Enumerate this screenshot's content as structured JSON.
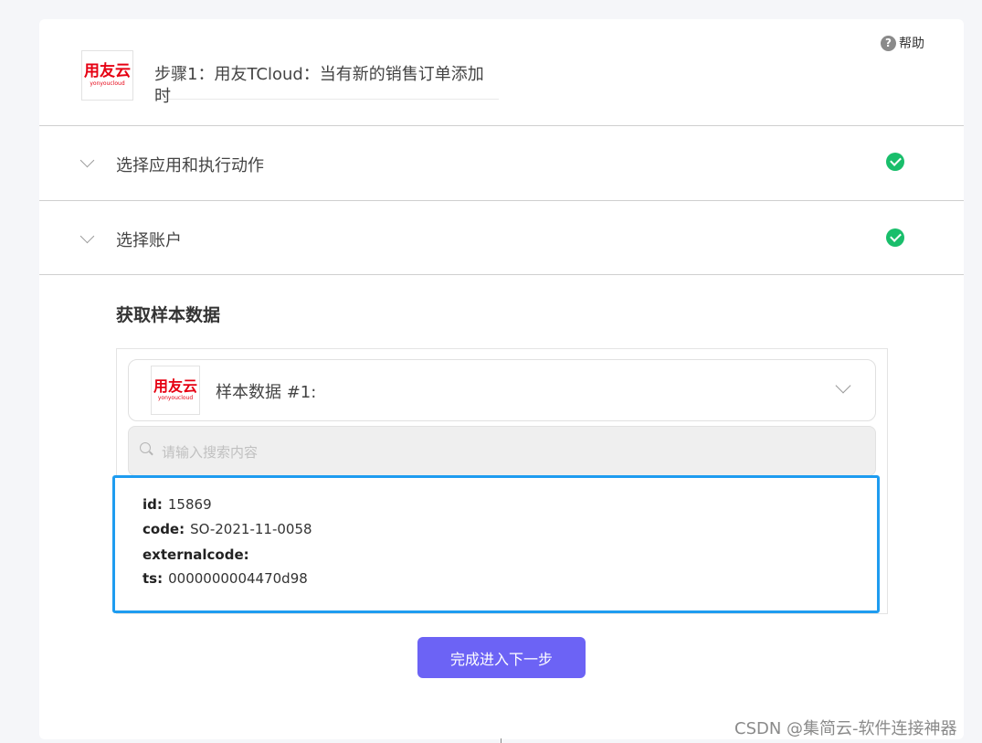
{
  "help": {
    "label": "帮助",
    "icon": "question-circle-icon"
  },
  "step": {
    "logo_text": "用友云",
    "logo_subtext": "yonyoucloud",
    "title": "步骤1：用友TCloud：当有新的销售订单添加时"
  },
  "sections": [
    {
      "label": "选择应用和执行动作",
      "status": "completed"
    },
    {
      "label": "选择账户",
      "status": "completed"
    }
  ],
  "sample": {
    "heading": "获取样本数据",
    "selected_label": "样本数据 #1:",
    "search_placeholder": "请输入搜索内容",
    "fields": [
      {
        "key": "id:",
        "value": "15869"
      },
      {
        "key": "code:",
        "value": "SO-2021-11-0058"
      },
      {
        "key": "externalcode:",
        "value": ""
      },
      {
        "key": "ts:",
        "value": "0000000004470d98"
      }
    ]
  },
  "next_button": "完成进入下一步",
  "watermark": "CSDN @集简云-软件连接神器",
  "colors": {
    "accent": "#6c63f5",
    "success": "#19be6b",
    "highlight_border": "#1e9cf0",
    "brand_red": "#e60012"
  }
}
